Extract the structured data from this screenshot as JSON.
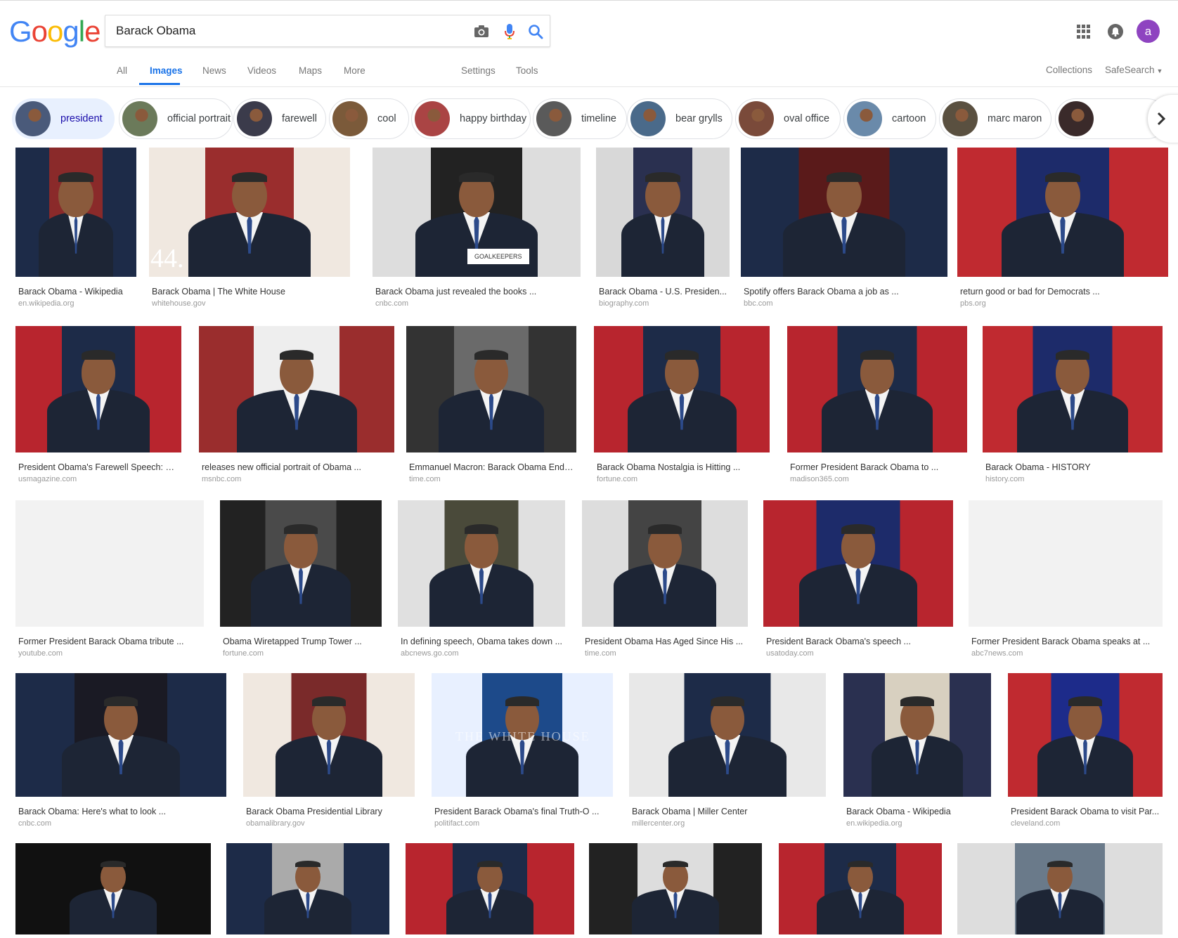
{
  "search": {
    "query": "Barack Obama"
  },
  "header": {
    "logo_letters": [
      {
        "ch": "G",
        "color": "#4285F4"
      },
      {
        "ch": "o",
        "color": "#EA4335"
      },
      {
        "ch": "o",
        "color": "#FBBC05"
      },
      {
        "ch": "g",
        "color": "#4285F4"
      },
      {
        "ch": "l",
        "color": "#34A853"
      },
      {
        "ch": "e",
        "color": "#EA4335"
      }
    ],
    "avatar_letter": "a",
    "icons": [
      "camera-icon",
      "microphone-icon",
      "search-icon",
      "apps-icon",
      "notifications-icon"
    ]
  },
  "tabs": {
    "all": "All",
    "images": "Images",
    "news": "News",
    "videos": "Videos",
    "maps": "Maps",
    "more": "More",
    "settings": "Settings",
    "tools": "Tools",
    "collections": "Collections",
    "safesearch": "SafeSearch"
  },
  "chips": [
    {
      "label": "president",
      "active": true
    },
    {
      "label": "official portrait"
    },
    {
      "label": "farewell"
    },
    {
      "label": "cool"
    },
    {
      "label": "happy birthday"
    },
    {
      "label": "timeline"
    },
    {
      "label": "bear grylls"
    },
    {
      "label": "oval office"
    },
    {
      "label": "cartoon"
    },
    {
      "label": "marc maron"
    }
  ],
  "results": [
    {
      "title": "Barack Obama - Wikipedia",
      "source": "en.wikipedia.org"
    },
    {
      "title": "Barack Obama | The White House",
      "source": "whitehouse.gov"
    },
    {
      "title": "Barack Obama just revealed the books ...",
      "source": "cnbc.com"
    },
    {
      "title": "Barack Obama - U.S. Presiden...",
      "source": "biography.com"
    },
    {
      "title": "Spotify offers Barack Obama a job as ...",
      "source": "bbc.com"
    },
    {
      "title": "return good or bad for Democrats ...",
      "source": "pbs.org"
    },
    {
      "title": "President Obama's Farewell Speech: W...",
      "source": "usmagazine.com"
    },
    {
      "title": "releases new official portrait of Obama ...",
      "source": "msnbc.com"
    },
    {
      "title": "Emmanuel Macron: Barack Obama Endor...",
      "source": "time.com"
    },
    {
      "title": "Barack Obama Nostalgia is Hitting ...",
      "source": "fortune.com"
    },
    {
      "title": "Former President Barack Obama to ...",
      "source": "madison365.com"
    },
    {
      "title": "Barack Obama - HISTORY",
      "source": "history.com"
    },
    {
      "title": "Former President Barack Obama tribute ...",
      "source": "youtube.com"
    },
    {
      "title": "Obama Wiretapped Trump Tower ...",
      "source": "fortune.com"
    },
    {
      "title": "In defining speech, Obama takes down ...",
      "source": "abcnews.go.com"
    },
    {
      "title": "President Obama Has Aged Since His ...",
      "source": "time.com"
    },
    {
      "title": "President Barack Obama's speech ...",
      "source": "usatoday.com"
    },
    {
      "title": "Former President Barack Obama speaks at ...",
      "source": "abc7news.com"
    },
    {
      "title": "Barack Obama: Here's what to look ...",
      "source": "cnbc.com"
    },
    {
      "title": "Barack Obama Presidential Library",
      "source": "obamalibrary.gov"
    },
    {
      "title": "President Barack Obama's final Truth-O ...",
      "source": "politifact.com"
    },
    {
      "title": "Barack Obama | Miller Center",
      "source": "millercenter.org"
    },
    {
      "title": "Barack Obama - Wikipedia",
      "source": "en.wikipedia.org"
    },
    {
      "title": "President Barack Obama to visit Par...",
      "source": "cleveland.com"
    }
  ],
  "image_overlay_text": {
    "number_44": "44.",
    "podium_sign": "GOALKEEPERS",
    "building_text": "THE WHITE HOUSE"
  }
}
